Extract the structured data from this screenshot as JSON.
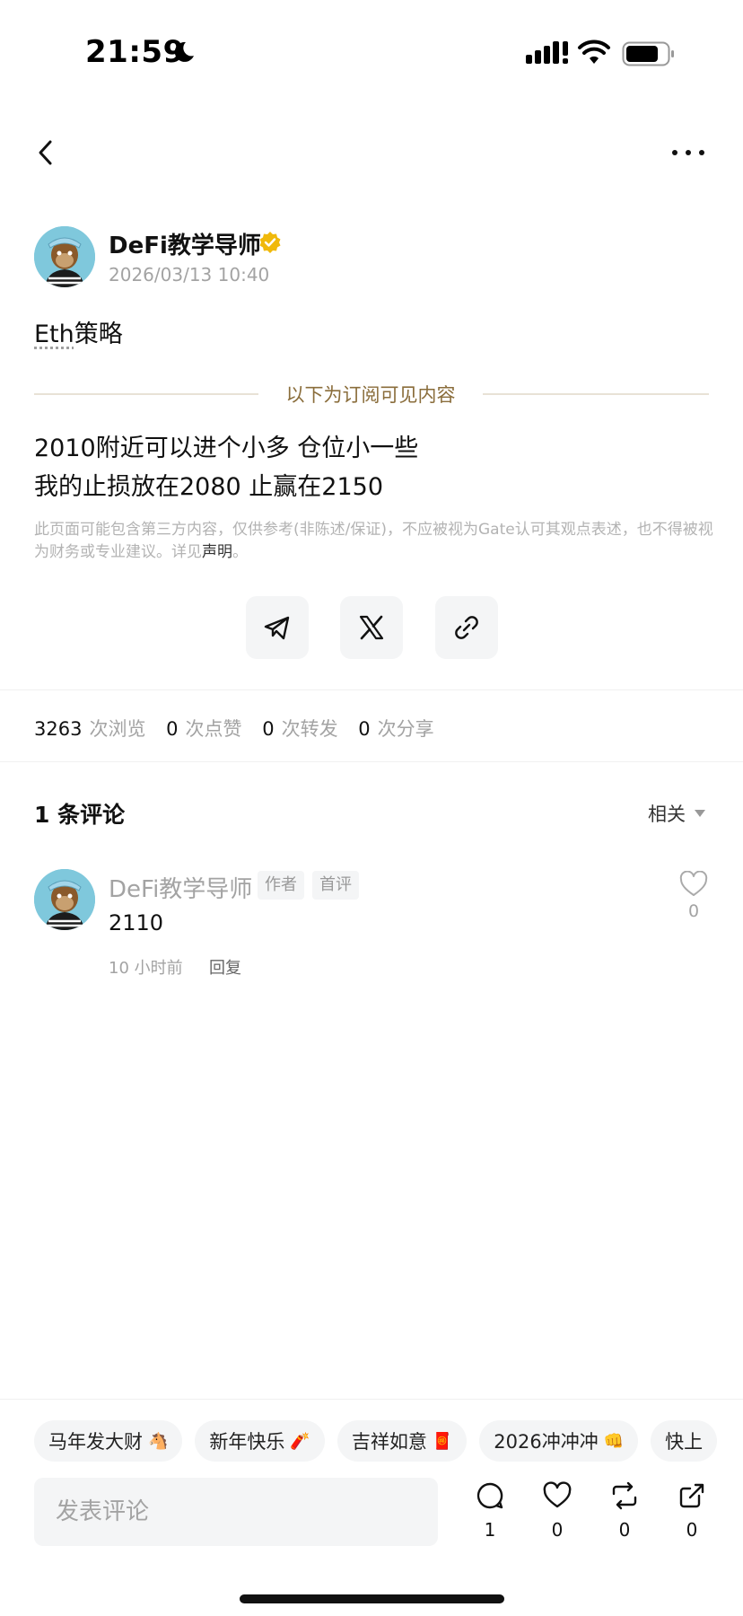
{
  "status_bar": {
    "time": "21:59"
  },
  "icons": {
    "moon": "moon-icon",
    "signal": "signal-icon",
    "wifi": "wifi-icon",
    "battery": "battery-icon",
    "back": "chevron-left-icon",
    "more": "more-icon",
    "verified": "verified-badge-icon",
    "telegram": "telegram-icon",
    "x": "x-logo-icon",
    "link": "link-icon",
    "heart": "heart-icon",
    "comment": "comment-icon",
    "repost": "repost-icon",
    "share": "share-icon"
  },
  "post": {
    "author": "DeFi教学导师",
    "time": "2026/03/13 10:40",
    "title_token": "Eth",
    "title_rest": "策略",
    "subscribe_divider": "以下为订阅可见内容",
    "content_lines": [
      "2010附近可以进个小多 仓位小一些",
      "我的止损放在2080 止赢在2150"
    ],
    "disclaimer": "此页面可能包含第三方内容，仅供参考(非陈述/保证)，不应被视为Gate认可其观点表述，也不得被视为财务或专业建议。详见",
    "disclaimer_link": "声明",
    "disclaimer_end": "。"
  },
  "stats": {
    "views": "3263",
    "views_label": "次浏览",
    "likes": "0",
    "likes_label": "次点赞",
    "reposts": "0",
    "reposts_label": "次转发",
    "shares": "0",
    "shares_label": "次分享"
  },
  "comments": {
    "title": "1 条评论",
    "sort": "相关",
    "items": [
      {
        "author": "DeFi教学导师",
        "tag_author": "作者",
        "tag_first": "首评",
        "text": "2110",
        "time": "10 小时前",
        "reply": "回复",
        "likes": "0"
      }
    ]
  },
  "chips": [
    {
      "label": "马年发大财",
      "emoji": "🐴"
    },
    {
      "label": "新年快乐",
      "emoji": "🧨"
    },
    {
      "label": "吉祥如意",
      "emoji": "🧧"
    },
    {
      "label": "2026冲冲冲",
      "emoji": "👊"
    },
    {
      "label": "快上",
      "emoji": ""
    }
  ],
  "bottom_bar": {
    "input_placeholder": "发表评论",
    "comment_count": "1",
    "like_count": "0",
    "repost_count": "0",
    "share_count": "0"
  }
}
